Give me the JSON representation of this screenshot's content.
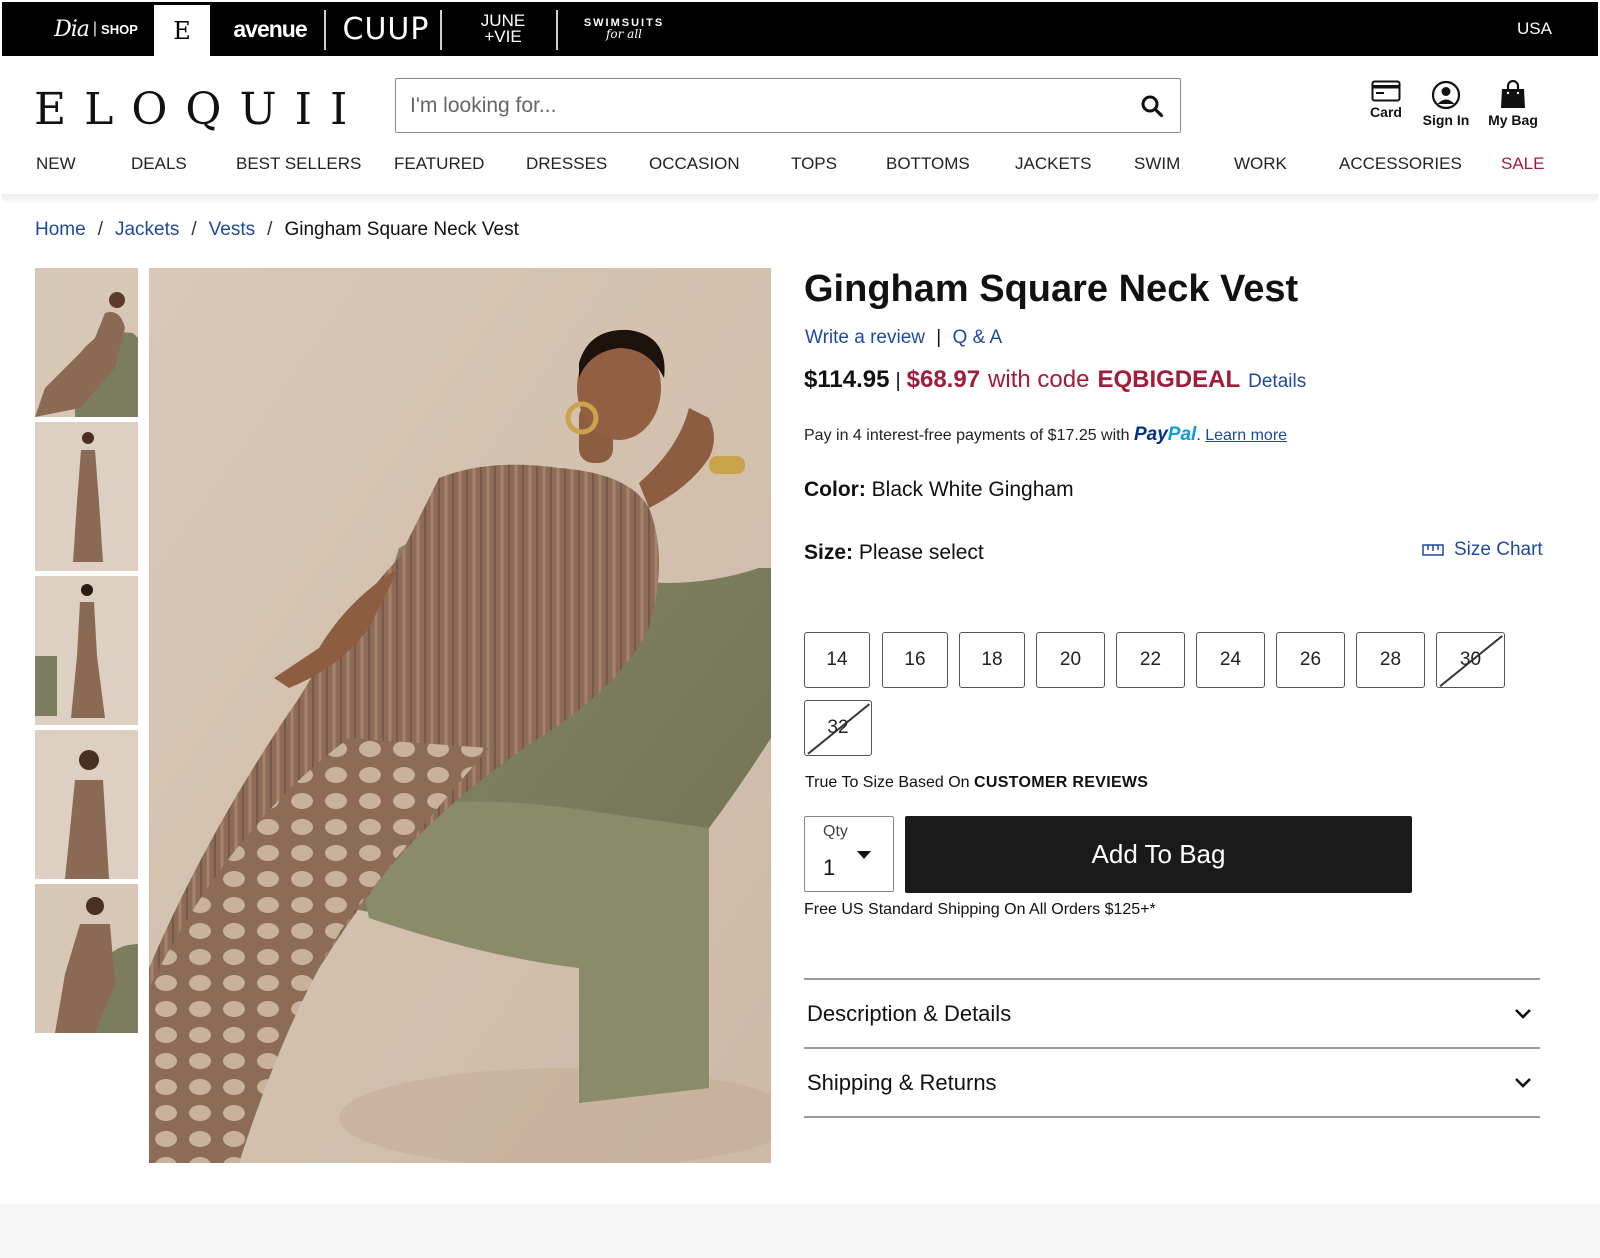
{
  "brands": {
    "dia_script": "Dia",
    "dia_shop": "SHOP",
    "eloquii_short": "E",
    "avenue": "avenue",
    "cuup": "CUUP",
    "june_line1": "JUNE",
    "june_line2": "+VIE",
    "swim_line1": "SWIMSUITS",
    "swim_line2": "for all"
  },
  "country": "USA",
  "logo": "ELOQUII",
  "search": {
    "placeholder": "I'm looking for..."
  },
  "header_icons": {
    "card": "Card",
    "sign_in": "Sign In",
    "bag": "My Bag"
  },
  "nav": {
    "items": [
      "NEW",
      "DEALS",
      "BEST SELLERS",
      "FEATURED",
      "DRESSES",
      "OCCASION",
      "TOPS",
      "BOTTOMS",
      "JACKETS",
      "SWIM",
      "WORK",
      "ACCESSORIES",
      "SALE"
    ],
    "sale_color": "#a11c3a"
  },
  "breadcrumb": {
    "home": "Home",
    "jackets": "Jackets",
    "vests": "Vests",
    "current": "Gingham Square Neck Vest",
    "sep": "/"
  },
  "product": {
    "title": "Gingham Square Neck Vest",
    "write_review": "Write a review",
    "review_sep": "|",
    "qa": "Q & A",
    "price_original": "$114.95",
    "price_bar": "|",
    "price_sale": "$68.97",
    "with_code": "with code",
    "promo_code": "EQBIGDEAL",
    "details_link": "Details",
    "paypal_text": "Pay in 4 interest-free payments of $17.25 with",
    "paypal_logo_a": "Pay",
    "paypal_logo_b": "Pal",
    "paypal_dot": ".",
    "paypal_learn": "Learn more",
    "color_label": "Color:",
    "color_value": "Black White Gingham",
    "size_label": "Size:",
    "size_value": "Please select",
    "size_chart": "Size Chart",
    "sizes": [
      {
        "label": "14",
        "available": true
      },
      {
        "label": "16",
        "available": true
      },
      {
        "label": "18",
        "available": true
      },
      {
        "label": "20",
        "available": true
      },
      {
        "label": "22",
        "available": true
      },
      {
        "label": "24",
        "available": true
      },
      {
        "label": "26",
        "available": true
      },
      {
        "label": "28",
        "available": true
      },
      {
        "label": "30",
        "available": false
      },
      {
        "label": "32",
        "available": false
      }
    ],
    "true_to_size": "True To Size Based On",
    "customer_reviews": "CUSTOMER REVIEWS",
    "qty_label": "Qty",
    "qty_value": "1",
    "add_to_bag": "Add To Bag",
    "free_shipping": "Free US Standard Shipping On All Orders $125+*",
    "accordions": [
      "Description & Details",
      "Shipping & Returns"
    ]
  },
  "colors": {
    "link": "#1f4a9c",
    "sale": "#a11c3a",
    "cta": "#1a1a1a"
  }
}
